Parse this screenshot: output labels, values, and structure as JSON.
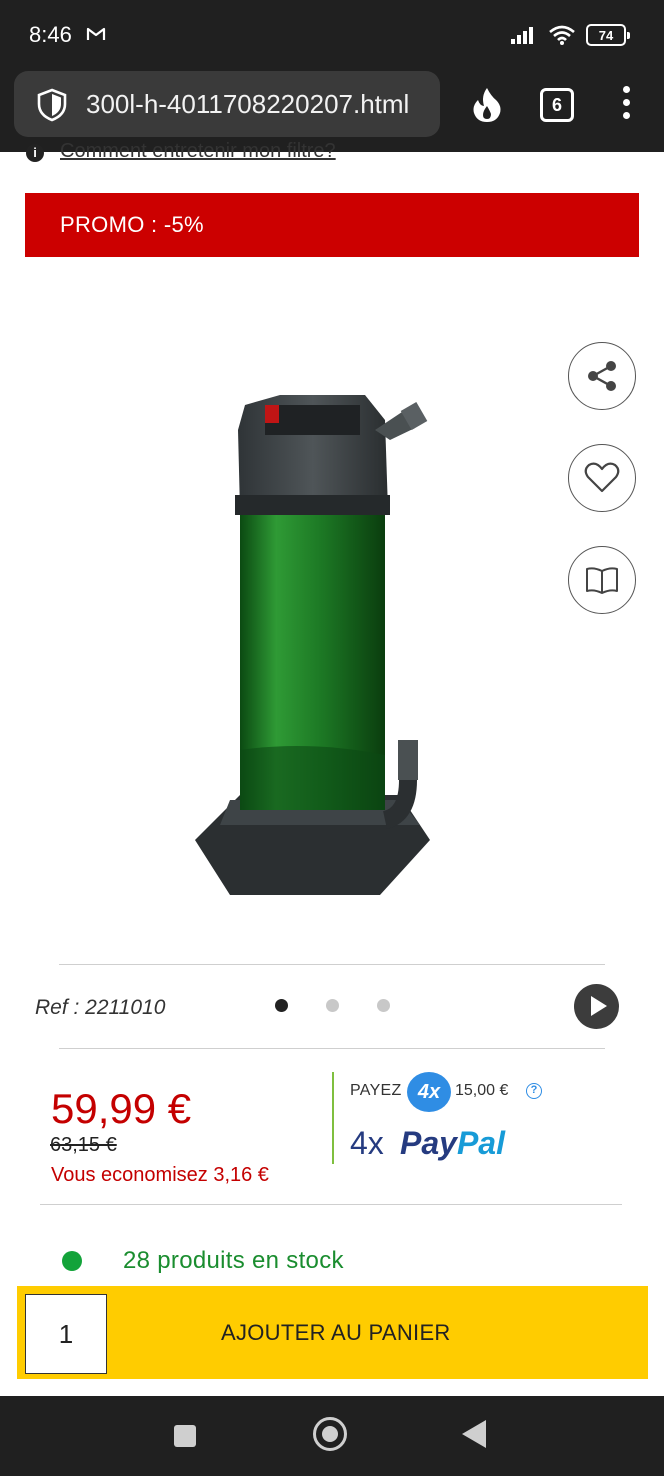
{
  "status_bar": {
    "time": "8:46",
    "battery": "74",
    "icons": [
      "gmail-icon",
      "signal-icon",
      "wifi-icon",
      "battery-icon"
    ]
  },
  "browser": {
    "url": "300l-h-4011708220207.html",
    "tab_count": "6",
    "icons": [
      "shield-icon",
      "flame-icon",
      "tabs-icon",
      "menu-icon"
    ]
  },
  "page": {
    "care_link": "Comment entretenir mon filtre?",
    "promo_label": "PROMO : -5%",
    "side_actions": [
      "share-icon",
      "heart-icon",
      "book-icon"
    ],
    "ref": "Ref : 2211010",
    "gallery": {
      "total_dots": 3,
      "active_index": 0
    },
    "price": {
      "current": "59,99 €",
      "old": "63,15 €",
      "savings": "Vous economisez 3,16 €"
    },
    "payment": {
      "payez_label": "PAYEZ",
      "badge": "4x",
      "installment": "15,00 €",
      "help": "?",
      "paypal_prefix": "4x",
      "paypal_pay": "Pay",
      "paypal_pal": "Pal"
    },
    "stock": "28 produits en stock",
    "cart": {
      "quantity": "1",
      "button_label": "AJOUTER AU PANIER"
    }
  },
  "colors": {
    "promo": "#cc0000",
    "price": "#c40000",
    "stock": "#13a33a",
    "cart": "#ffcc00",
    "paypal_dark": "#253b80",
    "paypal_light": "#179bd7"
  }
}
